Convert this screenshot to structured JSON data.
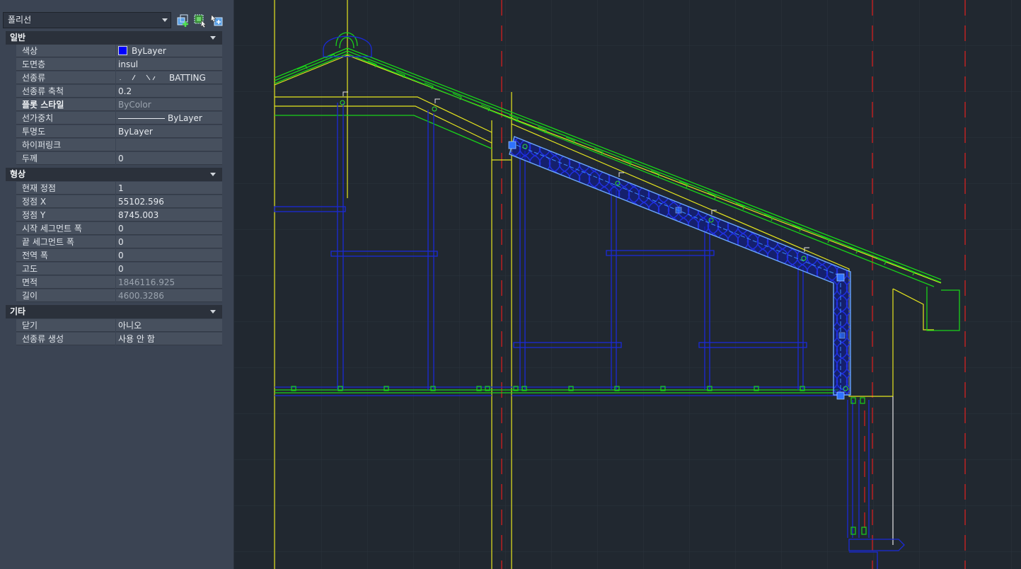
{
  "palette": {
    "object_type": "폴리선",
    "toolbar_icons": [
      "add-to-selection-icon",
      "quick-select-icon",
      "toggle-pickadd-icon"
    ],
    "sections": {
      "general": {
        "title": "일반",
        "rows": {
          "color": {
            "label": "색상",
            "value": "ByLayer",
            "swatch": "#0000ff"
          },
          "layer": {
            "label": "도면층",
            "value": "insul"
          },
          "linetype": {
            "label": "선종류",
            "value": "BATTING"
          },
          "ltscale": {
            "label": "선종류 축척",
            "value": "0.2"
          },
          "plotstyle": {
            "label": "플롯 스타일",
            "value": "ByColor"
          },
          "lineweight": {
            "label": "선가중치",
            "value": "ByLayer"
          },
          "transparency": {
            "label": "투명도",
            "value": "ByLayer"
          },
          "hyperlink": {
            "label": "하이퍼링크",
            "value": ""
          },
          "thickness": {
            "label": "두께",
            "value": "0"
          }
        }
      },
      "geometry": {
        "title": "형상",
        "rows": {
          "current_vertex": {
            "label": "현재 정점",
            "value": "1"
          },
          "vertex_x": {
            "label": "정점 X",
            "value": "55102.596"
          },
          "vertex_y": {
            "label": "정점 Y",
            "value": "8745.003"
          },
          "start_width": {
            "label": "시작 세그먼트 폭",
            "value": "0"
          },
          "end_width": {
            "label": "끝 세그먼트 폭",
            "value": "0"
          },
          "global_width": {
            "label": "전역 폭",
            "value": "0"
          },
          "elevation": {
            "label": "고도",
            "value": "0"
          },
          "area": {
            "label": "면적",
            "value": "1846116.925"
          },
          "length": {
            "label": "길이",
            "value": "4600.3286"
          }
        }
      },
      "misc": {
        "title": "기타",
        "rows": {
          "closed": {
            "label": "닫기",
            "value": "아니오"
          },
          "ltgen": {
            "label": "선종류 생성",
            "value": "사용 안 함"
          }
        }
      }
    }
  },
  "colors": {
    "canvas": "#212830",
    "yellow": "#e6e61e",
    "green": "#19d219",
    "blue": "#1a2ad8",
    "selection": "#2e72ff",
    "red": "#d21e1e"
  }
}
